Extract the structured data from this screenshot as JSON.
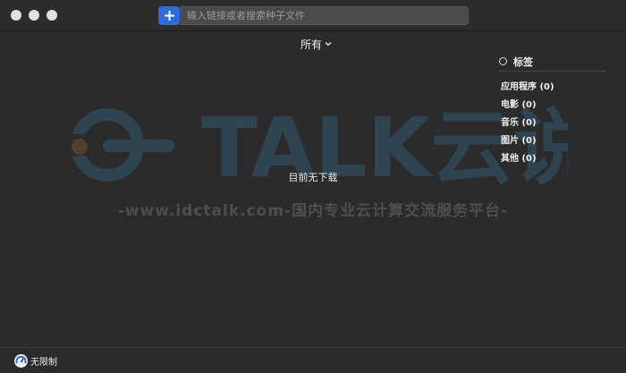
{
  "toolbar": {
    "add_icon": "plus-icon",
    "search_placeholder": "输入链接或者搜索种子文件"
  },
  "filter": {
    "selected": "所有",
    "icon": "chevron-down-icon"
  },
  "tags": {
    "header": "标签",
    "items": [
      {
        "label": "应用程序 (0)"
      },
      {
        "label": "电影 (0)"
      },
      {
        "label": "音乐 (0)"
      },
      {
        "label": "图片 (0)"
      },
      {
        "label": "其他 (0)"
      }
    ]
  },
  "main": {
    "empty_text": "目前无下载"
  },
  "watermark": {
    "logo_text": "TALK云说",
    "line": "-www.idctalk.com-国内专业云计算交流服务平台-"
  },
  "footer": {
    "speed_label": "无限制",
    "speed_icon": "speedometer-icon"
  },
  "colors": {
    "accent": "#2f6be0",
    "background": "#2b2b2b"
  }
}
